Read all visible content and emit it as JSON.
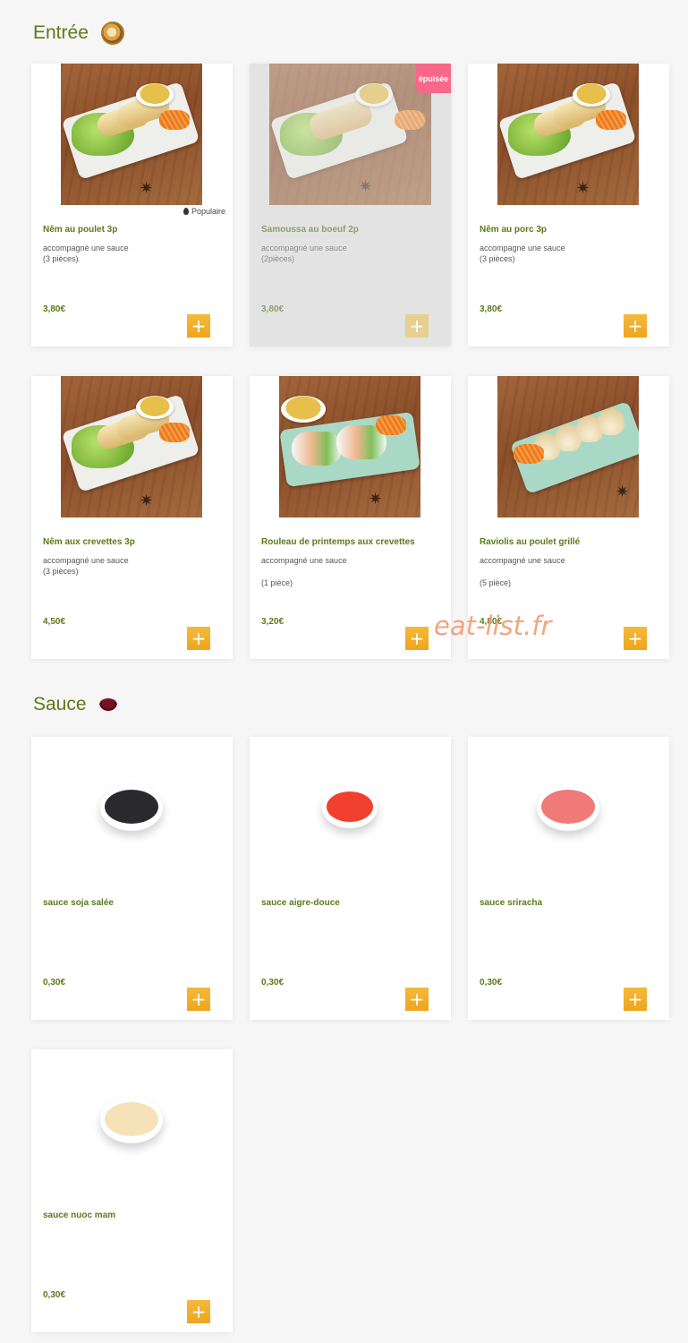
{
  "sections": {
    "entree": {
      "title": "Entrée",
      "icon": "dumpling-basket-icon"
    },
    "sauce": {
      "title": "Sauce",
      "icon": "sauce-bowl-icon"
    }
  },
  "badges": {
    "soldout": "épuisée",
    "popular": "Populaire"
  },
  "entrees": [
    {
      "name": "Nêm au poulet 3p",
      "desc1": "accompagné une sauce",
      "desc2": "(3 pièces)",
      "price": "3,80€",
      "popular": true,
      "soldout": false
    },
    {
      "name": "Samoussa au boeuf 2p",
      "desc1": "accompagné une sauce",
      "desc2": "(2pièces)",
      "price": "3,80€",
      "popular": false,
      "soldout": true
    },
    {
      "name": "Nêm au porc 3p",
      "desc1": "accompagné une sauce",
      "desc2": "(3 pièces)",
      "price": "3,80€",
      "popular": false,
      "soldout": false
    },
    {
      "name": "Nêm aux crevettes 3p",
      "desc1": "accompagné une sauce",
      "desc2": "(3 pièces)",
      "price": "4,50€",
      "popular": false,
      "soldout": false
    },
    {
      "name": "Rouleau de printemps aux crevettes",
      "desc1": "accompagné une sauce",
      "desc2": "(1 pièce)",
      "price": "3,20€",
      "popular": false,
      "soldout": false
    },
    {
      "name": "Raviolis au poulet grillé",
      "desc1": "accompagné une sauce",
      "desc2": "(5 pièce)",
      "price": "4,80€",
      "popular": false,
      "soldout": false
    }
  ],
  "sauces": [
    {
      "name": "sauce soja salée",
      "price": "0,30€",
      "color": "#2a2a2e"
    },
    {
      "name": "sauce aigre-douce",
      "price": "0,30€",
      "color": "#f2402e"
    },
    {
      "name": "sauce sriracha",
      "price": "0,30€",
      "color": "#ef7a78"
    },
    {
      "name": "sauce nuoc mam",
      "price": "0,30€",
      "color": "#f6e2b8"
    }
  ],
  "add_label": "+",
  "watermark": "eat-list.fr",
  "colors": {
    "accent": "#5b7a1a",
    "button": "#f0a41d",
    "soldout_badge": "#f7688a"
  }
}
